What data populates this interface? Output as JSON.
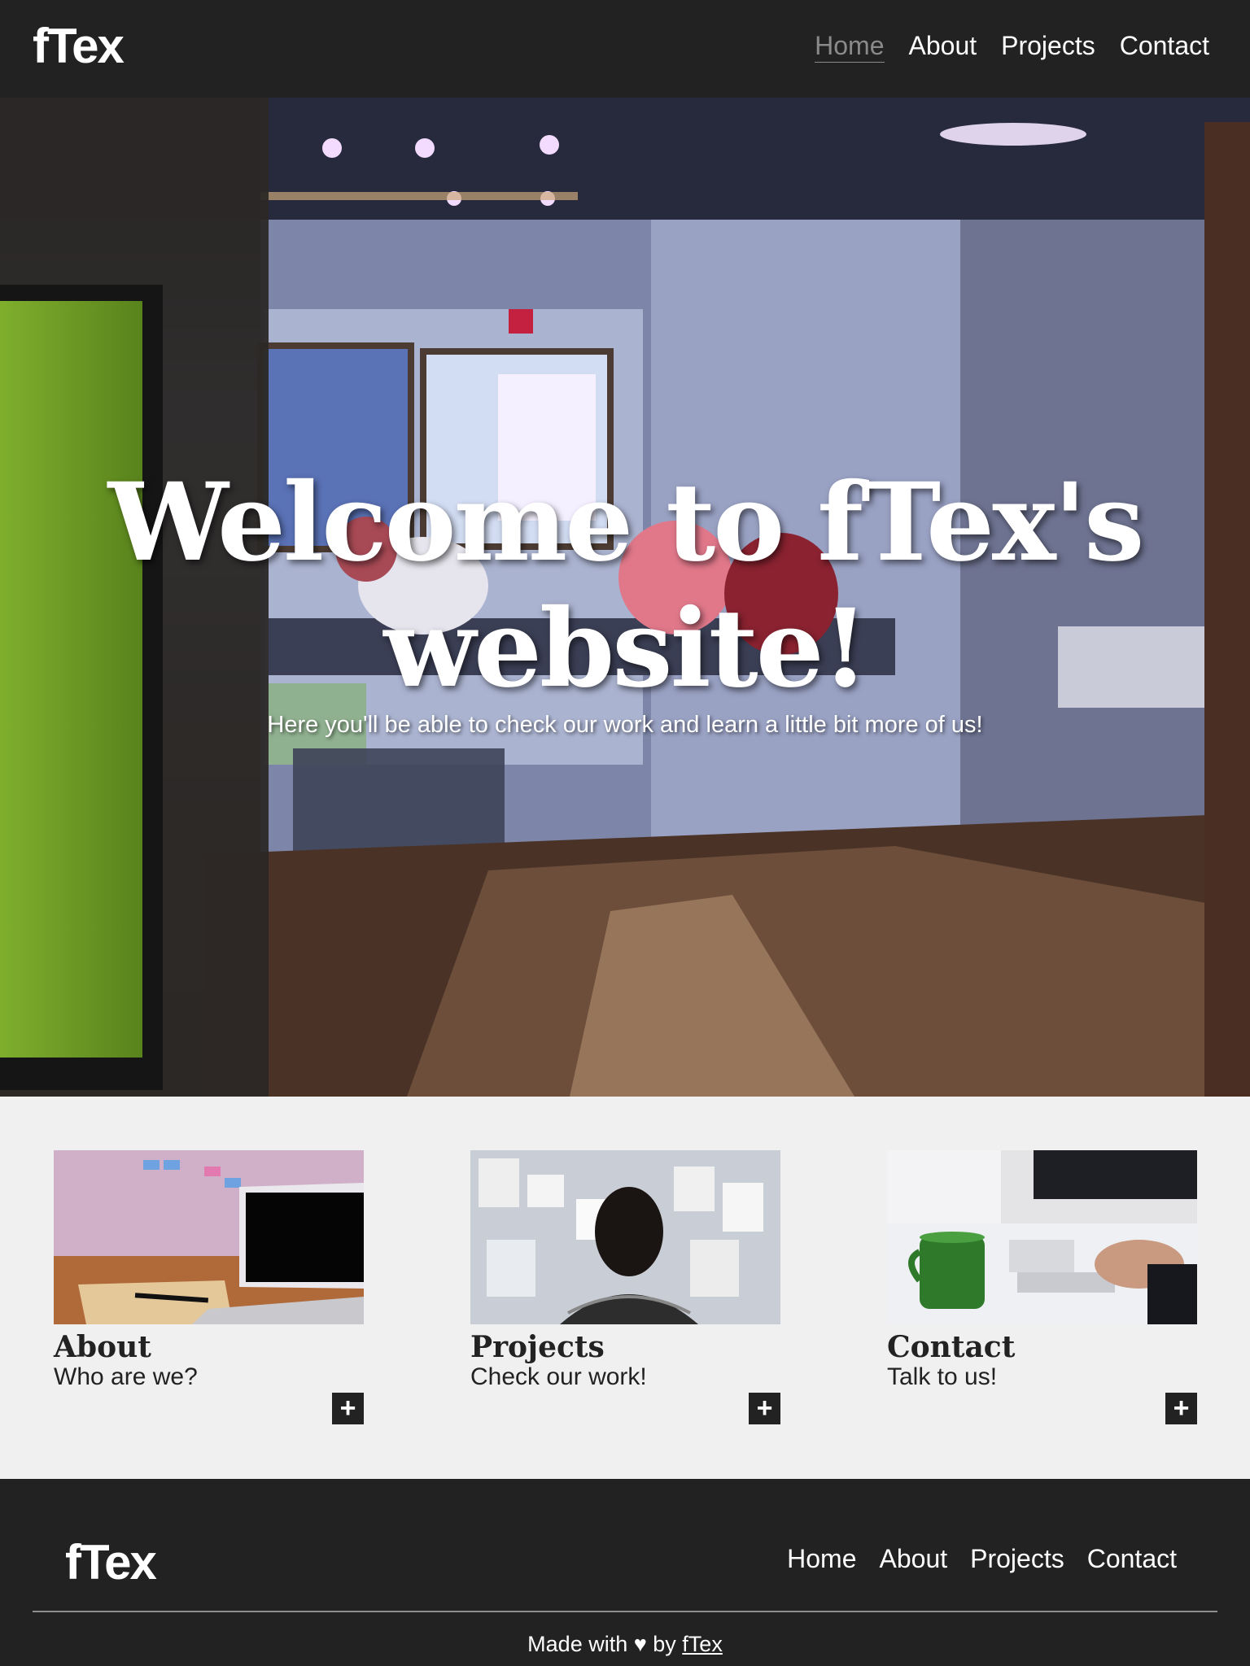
{
  "header": {
    "logo": "fTex",
    "nav": [
      {
        "label": "Home",
        "active": true
      },
      {
        "label": "About",
        "active": false
      },
      {
        "label": "Projects",
        "active": false
      },
      {
        "label": "Contact",
        "active": false
      }
    ]
  },
  "hero": {
    "title": "Welcome to fTex's website!",
    "subtitle": "Here you'll be able to check our work and learn a little bit more of us!"
  },
  "cards": [
    {
      "title": "About",
      "description": "Who are we?",
      "button": "+"
    },
    {
      "title": "Projects",
      "description": "Check our work!",
      "button": "+"
    },
    {
      "title": "Contact",
      "description": "Talk to us!",
      "button": "+"
    }
  ],
  "footer": {
    "logo": "fTex",
    "nav": [
      "Home",
      "About",
      "Projects",
      "Contact"
    ],
    "credit_prefix": "Made with ♥ by",
    "credit_link": "fTex"
  },
  "colors": {
    "header_bg": "#222222",
    "page_bg": "#f0f0f0",
    "active_nav": "#8a8a8a"
  }
}
